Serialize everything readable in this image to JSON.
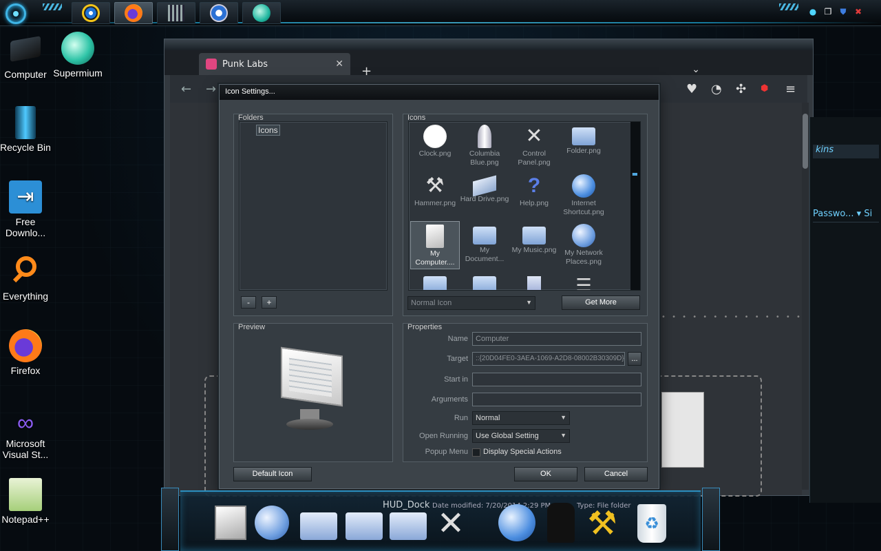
{
  "taskbar": {
    "buttons": [
      "ie-icon",
      "firefox-icon",
      "media-icon",
      "play-icon",
      "supermium-icon"
    ]
  },
  "desktop": {
    "icons": [
      {
        "label": "Computer",
        "icon": "computer-icon"
      },
      {
        "label": "Supermium",
        "icon": "supermium-icon"
      },
      {
        "label": "Recycle Bin",
        "icon": "recycle-bin-icon"
      },
      {
        "label": "Free Downlo...",
        "icon": "free-download-manager-icon"
      },
      {
        "label": "Everything",
        "icon": "everything-search-icon"
      },
      {
        "label": "Firefox",
        "icon": "firefox-icon"
      },
      {
        "label": "Microsoft Visual St...",
        "icon": "visual-studio-icon"
      },
      {
        "label": "Notepad++",
        "icon": "notepadpp-icon"
      }
    ]
  },
  "browser": {
    "tab_title": "Punk Labs",
    "tab_close": "✕",
    "new_tab": "+",
    "right_panel_search": "kins",
    "right_panel_password": "Passwo...",
    "right_panel_si": "Si"
  },
  "dialog": {
    "title": "Icon Settings...",
    "folders": {
      "label": "Folders",
      "items": [
        "Icons"
      ],
      "remove_label": "-",
      "add_label": "+"
    },
    "icons": {
      "label": "Icons",
      "items": [
        {
          "name": "Clock.png",
          "icon": "clock-icon"
        },
        {
          "name": "Columbia Blue.png",
          "icon": "shuttle-icon"
        },
        {
          "name": "Control Panel.png",
          "icon": "control-panel-icon"
        },
        {
          "name": "Folder.png",
          "icon": "folder-icon"
        },
        {
          "name": "Hammer.png",
          "icon": "hammer-icon"
        },
        {
          "name": "Hard Drive.png",
          "icon": "hard-drive-icon"
        },
        {
          "name": "Help.png",
          "icon": "help-icon"
        },
        {
          "name": "Internet Shortcut.png",
          "icon": "globe-icon"
        },
        {
          "name": "My Computer....",
          "icon": "my-computer-icon"
        },
        {
          "name": "My Document...",
          "icon": "documents-folder-icon"
        },
        {
          "name": "My Music.png",
          "icon": "music-folder-icon"
        },
        {
          "name": "My Network Places.png",
          "icon": "network-icon"
        }
      ],
      "mode_select": "Normal Icon",
      "get_more_label": "Get More"
    },
    "preview": {
      "label": "Preview"
    },
    "properties": {
      "label": "Properties",
      "name_label": "Name",
      "name_value": "Computer",
      "target_label": "Target",
      "target_value": "::{20D04FE0-3AEA-1069-A2D8-08002B30309D}",
      "browse_label": "...",
      "start_in_label": "Start in",
      "start_in_value": "",
      "arguments_label": "Arguments",
      "arguments_value": "",
      "run_label": "Run",
      "run_value": "Normal",
      "open_running_label": "Open Running",
      "open_running_value": "Use Global Setting",
      "popup_menu_label": "Popup Menu",
      "popup_menu_check_label": "Display Special Actions"
    },
    "default_icon_label": "Default Icon",
    "ok_label": "OK",
    "cancel_label": "Cancel"
  },
  "dock": {
    "title": "HUD_Dock",
    "subtitle": "Date modified: 7/20/2014 2:29 PM",
    "type": "Type: File folder",
    "items": [
      "my-computer-icon",
      "network-icon",
      "documents-folder-icon",
      "music-folder-icon",
      "pictures-folder-icon",
      "control-panel-icon",
      "globe-icon",
      "help-figure-icon",
      "hammer-icon",
      "recycle-bin-icon"
    ]
  },
  "colors": {
    "accent": "#2ab0ea",
    "dialog_bg": "#3c4349",
    "desktop_bg": "#060b10"
  }
}
